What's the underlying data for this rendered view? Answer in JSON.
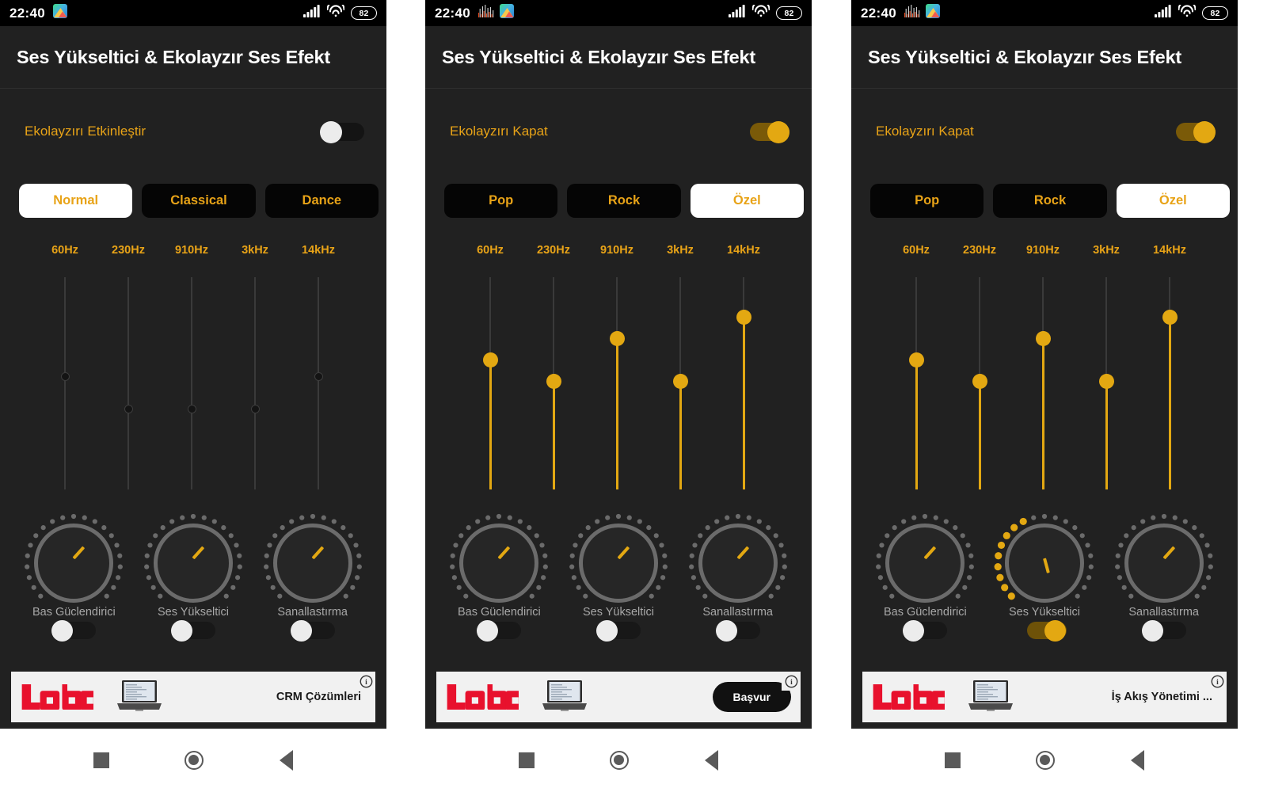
{
  "colors": {
    "accent": "#e8a317",
    "accent_knob": "#e3a812",
    "screen_bg": "#212121",
    "statusbar_bg": "#000000",
    "preset_bg": "#050505",
    "preset_active_bg": "#ffffff",
    "label_gray": "#a8a8a8",
    "ad_bg": "#f1f1f1",
    "logo_red": "#e8112d"
  },
  "statusbar": {
    "time": "22:40",
    "battery": "82",
    "icons": {
      "equalizer": "equalizer-notification-icon",
      "gallery": "gallery-notification-icon",
      "signal": "signal-bars-icon",
      "wifi": "wifi-icon",
      "battery": "battery-icon"
    }
  },
  "app": {
    "title": "Ses Yükseltici & Ekolayzır Ses Efekt"
  },
  "frequencies": [
    "60Hz",
    "230Hz",
    "910Hz",
    "3kHz",
    "14kHz"
  ],
  "knob_labels": [
    "Bas Güclendirici",
    "Ses Yükseltici",
    "Sanallastırma"
  ],
  "nav": {
    "recents": "recents-square-icon",
    "home": "home-circle-icon",
    "back": "back-triangle-icon"
  },
  "panels": [
    {
      "id": "panel-1",
      "statusbar_icons": [
        "gallery"
      ],
      "eq_toggle": {
        "label": "Ekolayzırı Etkinleştir",
        "on": false
      },
      "presets": [
        {
          "label": "Normal",
          "active": true
        },
        {
          "label": "Classical",
          "active": false
        },
        {
          "label": "Dance",
          "active": false
        }
      ],
      "sliders_enabled": false,
      "slider_values": [
        0.47,
        0.62,
        0.62,
        0.62,
        0.47
      ],
      "knobs": [
        {
          "label": "Bas Güclendirici",
          "angle": 222,
          "filled_dots": 0,
          "toggle_on": false
        },
        {
          "label": "Ses Yükseltici",
          "angle": 222,
          "filled_dots": 0,
          "toggle_on": false
        },
        {
          "label": "Sanallastırma",
          "angle": 222,
          "filled_dots": 0,
          "toggle_on": false
        }
      ],
      "ad": {
        "brand": "logo",
        "text": "CRM Çözümleri",
        "button": null,
        "info": "ad-info-icon"
      }
    },
    {
      "id": "panel-2",
      "statusbar_icons": [
        "equalizer",
        "gallery"
      ],
      "eq_toggle": {
        "label": "Ekolayzırı Kapat",
        "on": true
      },
      "presets": [
        {
          "label": "Pop",
          "active": false
        },
        {
          "label": "Rock",
          "active": false
        },
        {
          "label": "Özel",
          "active": true
        }
      ],
      "sliders_enabled": true,
      "slider_values": [
        0.39,
        0.49,
        0.29,
        0.49,
        0.19
      ],
      "knobs": [
        {
          "label": "Bas Güclendirici",
          "angle": 222,
          "filled_dots": 0,
          "toggle_on": false
        },
        {
          "label": "Ses Yükseltici",
          "angle": 222,
          "filled_dots": 0,
          "toggle_on": false
        },
        {
          "label": "Sanallastırma",
          "angle": 222,
          "filled_dots": 0,
          "toggle_on": false
        }
      ],
      "ad": {
        "brand": "logo",
        "text": null,
        "button": "Başvur",
        "info": "ad-info-icon"
      }
    },
    {
      "id": "panel-3",
      "statusbar_icons": [
        "equalizer",
        "gallery"
      ],
      "eq_toggle": {
        "label": "Ekolayzırı Kapat",
        "on": true
      },
      "presets": [
        {
          "label": "Pop",
          "active": false
        },
        {
          "label": "Rock",
          "active": false
        },
        {
          "label": "Özel",
          "active": true
        }
      ],
      "sliders_enabled": true,
      "slider_values": [
        0.39,
        0.49,
        0.29,
        0.49,
        0.19
      ],
      "knobs": [
        {
          "label": "Bas Güclendirici",
          "angle": 222,
          "filled_dots": 0,
          "toggle_on": false
        },
        {
          "label": "Ses Yükseltici",
          "angle": 345,
          "filled_dots": 9,
          "toggle_on": true
        },
        {
          "label": "Sanallastırma",
          "angle": 222,
          "filled_dots": 0,
          "toggle_on": false
        }
      ],
      "ad": {
        "brand": "logo",
        "text": "İş Akış Yönetimi ...",
        "button": null,
        "info": "ad-info-icon"
      }
    }
  ]
}
